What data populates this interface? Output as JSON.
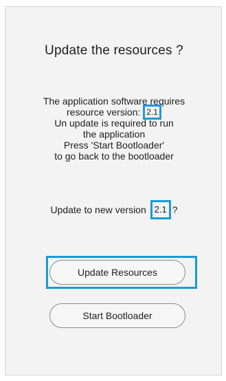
{
  "dialog": {
    "title": "Update the resources ?",
    "message": {
      "line1": "The application software requires",
      "line2_prefix": "resource version: ",
      "required_version": "2.1",
      "line3": "Un update is required to run",
      "line4": "the application",
      "line5": "Press 'Start Bootloader'",
      "line6": "to go back to the bootloader"
    },
    "question": {
      "prefix": "Update to new version",
      "new_version": "2.1",
      "suffix": "?"
    },
    "buttons": {
      "update_label": "Update Resources",
      "bootloader_label": "Start Bootloader"
    }
  },
  "colors": {
    "highlight": "#1a9ad6",
    "panel_background": "#f3f3f3"
  }
}
